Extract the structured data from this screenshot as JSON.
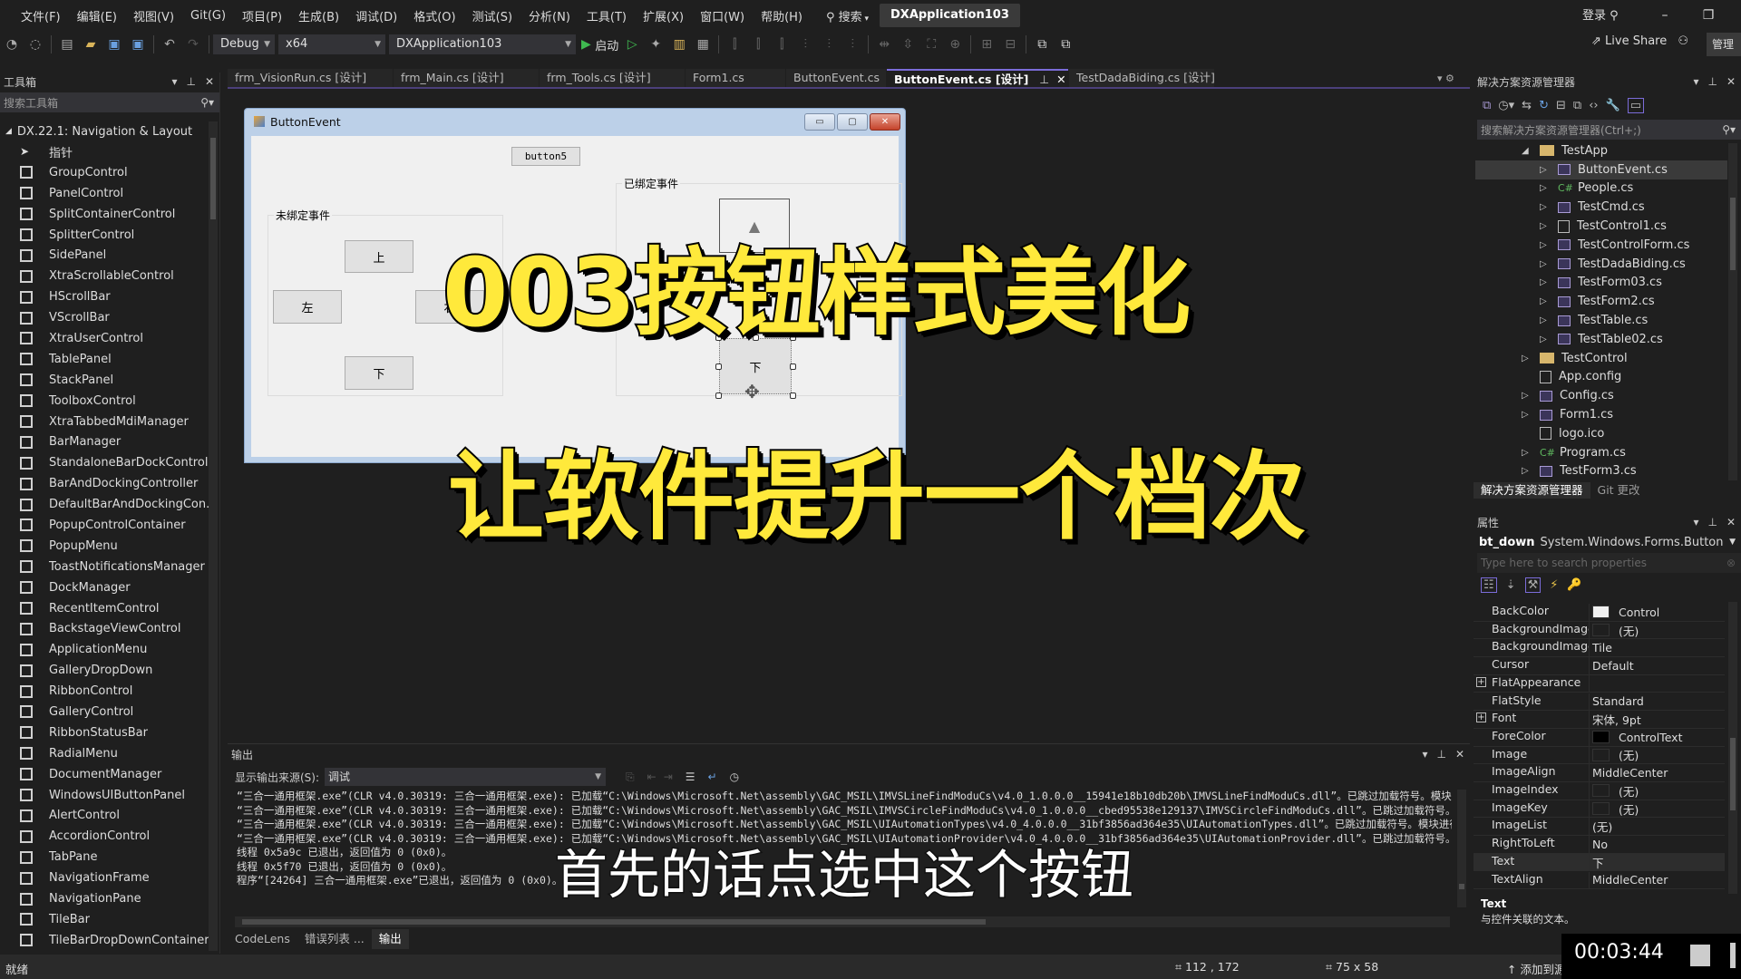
{
  "menubar": {
    "items": [
      "文件(F)",
      "编辑(E)",
      "视图(V)",
      "Git(G)",
      "项目(P)",
      "生成(B)",
      "调试(D)",
      "格式(O)",
      "测试(S)",
      "分析(N)",
      "工具(T)",
      "扩展(X)",
      "窗口(W)",
      "帮助(H)"
    ],
    "search_label": "搜索",
    "solution_name": "DXApplication103",
    "login_label": "登录"
  },
  "toolbar": {
    "config": "Debug",
    "platform": "x64",
    "startup_project": "DXApplication103",
    "start_label": "启动",
    "live_share": "Live Share",
    "manage_label": "管理"
  },
  "toolbox": {
    "title": "工具箱",
    "search_placeholder": "搜索工具箱",
    "group": "DX.22.1: Navigation & Layout",
    "items": [
      "指针",
      "GroupControl",
      "PanelControl",
      "SplitContainerControl",
      "SplitterControl",
      "SidePanel",
      "XtraScrollableControl",
      "HScrollBar",
      "VScrollBar",
      "XtraUserControl",
      "TablePanel",
      "StackPanel",
      "ToolboxControl",
      "XtraTabbedMdiManager",
      "BarManager",
      "StandaloneBarDockControl",
      "BarAndDockingController",
      "DefaultBarAndDockingCon...",
      "PopupControlContainer",
      "PopupMenu",
      "ToastNotificationsManager",
      "DockManager",
      "RecentItemControl",
      "BackstageViewControl",
      "ApplicationMenu",
      "GalleryDropDown",
      "RibbonControl",
      "GalleryControl",
      "RibbonStatusBar",
      "RadialMenu",
      "DocumentManager",
      "WindowsUIButtonPanel",
      "AlertControl",
      "AccordionControl",
      "TabPane",
      "NavigationFrame",
      "NavigationPane",
      "TileBar",
      "TileBarDropDownContainer"
    ]
  },
  "doc_tabs": [
    {
      "label": "frm_VisionRun.cs [设计]",
      "active": false
    },
    {
      "label": "frm_Main.cs [设计]",
      "active": false
    },
    {
      "label": "frm_Tools.cs [设计]",
      "active": false
    },
    {
      "label": "Form1.cs",
      "active": false
    },
    {
      "label": "ButtonEvent.cs",
      "active": false
    },
    {
      "label": "ButtonEvent.cs [设计]",
      "active": true
    },
    {
      "label": "TestDadaBiding.cs [设计]",
      "active": false
    }
  ],
  "form": {
    "title": "ButtonEvent",
    "button5": "button5",
    "group_unbound": "未绑定事件",
    "group_bound": "已绑定事件",
    "btn_up": "上",
    "btn_left": "左",
    "btn_right": "右",
    "btn_down": "下",
    "btn_down_selected": "下"
  },
  "overlay": {
    "title_line1": "003按钮样式美化",
    "title_line2": "让软件提升一个档次",
    "subtitle": "首先的话点选中这个按钮"
  },
  "output": {
    "title": "输出",
    "source_label": "显示输出来源(S):",
    "source_value": "调试",
    "lines": [
      "“三合一通用框架.exe”(CLR v4.0.30319: 三合一通用框架.exe): 已加载“C:\\Windows\\Microsoft.Net\\assembly\\GAC_MSIL\\IMVSLineFindModuCs\\v4.0_1.0.0.0__15941e18b10db20b\\IMVSLineFindModuCs.dll”。已跳过加载符号。模块进行了优",
      "“三合一通用框架.exe”(CLR v4.0.30319: 三合一通用框架.exe): 已加载“C:\\Windows\\Microsoft.Net\\assembly\\GAC_MSIL\\IMVSCircleFindModuCs\\v4.0_1.0.0.0__cbed95538e129137\\IMVSCircleFindModuCs.dll”。已跳过加载符号。模块进行",
      "“三合一通用框架.exe”(CLR v4.0.30319: 三合一通用框架.exe): 已加载“C:\\Windows\\Microsoft.Net\\assembly\\GAC_MSIL\\UIAutomationTypes\\v4.0_4.0.0.0__31bf3856ad364e35\\UIAutomationTypes.dll”。已跳过加载符号。模块进行了优化",
      "“三合一通用框架.exe”(CLR v4.0.30319: 三合一通用框架.exe): 已加载“C:\\Windows\\Microsoft.Net\\assembly\\GAC_MSIL\\UIAutomationProvider\\v4.0_4.0.0.0__31bf3856ad364e35\\UIAutomationProvider.dll”。已跳过加载符号。模块进行",
      "线程 0x5a9c 已退出，返回值为 0 (0x0)。",
      "线程 0x5f70 已退出，返回值为 0 (0x0)。",
      "程序“[24264] 三合一通用框架.exe”已退出，返回值为 0 (0x0)。"
    ],
    "tabs": [
      "CodeLens",
      "错误列表 ...",
      "输出"
    ]
  },
  "solution_explorer": {
    "title": "解决方案资源管理器",
    "search_placeholder": "搜索解决方案资源管理器(Ctrl+;)",
    "items": [
      {
        "label": "TestApp",
        "type": "folder",
        "level": 0,
        "expander": "open"
      },
      {
        "label": "ButtonEvent.cs",
        "type": "form",
        "level": 1,
        "expander": "closed",
        "selected": true
      },
      {
        "label": "People.cs",
        "type": "cs",
        "level": 1,
        "expander": "closed"
      },
      {
        "label": "TestCmd.cs",
        "type": "form",
        "level": 1,
        "expander": "closed"
      },
      {
        "label": "TestControl1.cs",
        "type": "usercontrol",
        "level": 1,
        "expander": "closed"
      },
      {
        "label": "TestControlForm.cs",
        "type": "form",
        "level": 1,
        "expander": "closed"
      },
      {
        "label": "TestDadaBiding.cs",
        "type": "form",
        "level": 1,
        "expander": "closed"
      },
      {
        "label": "TestForm03.cs",
        "type": "form",
        "level": 1,
        "expander": "closed"
      },
      {
        "label": "TestForm2.cs",
        "type": "form",
        "level": 1,
        "expander": "closed"
      },
      {
        "label": "TestTable.cs",
        "type": "form",
        "level": 1,
        "expander": "closed"
      },
      {
        "label": "TestTable02.cs",
        "type": "form",
        "level": 1,
        "expander": "closed"
      },
      {
        "label": "TestControl",
        "type": "folder",
        "level": 0,
        "expander": "closed"
      },
      {
        "label": "App.config",
        "type": "config",
        "level": 0,
        "expander": "none"
      },
      {
        "label": "Config.cs",
        "type": "form",
        "level": 0,
        "expander": "closed"
      },
      {
        "label": "Form1.cs",
        "type": "form",
        "level": 0,
        "expander": "closed"
      },
      {
        "label": "logo.ico",
        "type": "ico",
        "level": 0,
        "expander": "none"
      },
      {
        "label": "Program.cs",
        "type": "cs",
        "level": 0,
        "expander": "closed"
      },
      {
        "label": "TestForm3.cs",
        "type": "form",
        "level": 0,
        "expander": "closed"
      }
    ],
    "bottom_tabs": [
      "解决方案资源管理器",
      "Git 更改"
    ]
  },
  "properties": {
    "title": "属性",
    "object_name": "bt_down",
    "object_type": "System.Windows.Forms.Button",
    "search_placeholder": "Type here to search properties",
    "rows": [
      {
        "name": "BackColor",
        "value": "Control",
        "swatch": "#f0f0f0"
      },
      {
        "name": "BackgroundImage",
        "value": "(无)",
        "swatch": "#1f1f1f"
      },
      {
        "name": "BackgroundImageLayout",
        "value": "Tile"
      },
      {
        "name": "Cursor",
        "value": "Default"
      },
      {
        "name": "FlatAppearance",
        "value": "",
        "expandable": true
      },
      {
        "name": "FlatStyle",
        "value": "Standard"
      },
      {
        "name": "Font",
        "value": "宋体, 9pt",
        "expandable": true
      },
      {
        "name": "ForeColor",
        "value": "ControlText",
        "swatch": "#000000"
      },
      {
        "name": "Image",
        "value": "(无)",
        "swatch": "#1f1f1f"
      },
      {
        "name": "ImageAlign",
        "value": "MiddleCenter"
      },
      {
        "name": "ImageIndex",
        "value": "(无)",
        "swatch": "#1f1f1f"
      },
      {
        "name": "ImageKey",
        "value": "(无)",
        "swatch": "#1f1f1f"
      },
      {
        "name": "ImageList",
        "value": "(无)"
      },
      {
        "name": "RightToLeft",
        "value": "No"
      },
      {
        "name": "Text",
        "value": "下",
        "selected": true
      },
      {
        "name": "TextAlign",
        "value": "MiddleCenter"
      }
    ],
    "desc_title": "Text",
    "desc_text": "与控件关联的文本。"
  },
  "statusbar": {
    "ready": "就绪",
    "position": "112 , 172",
    "size": "75 x 58",
    "source_control": "添加到源代码管理"
  },
  "video": {
    "timestamp": "00:03:44"
  }
}
